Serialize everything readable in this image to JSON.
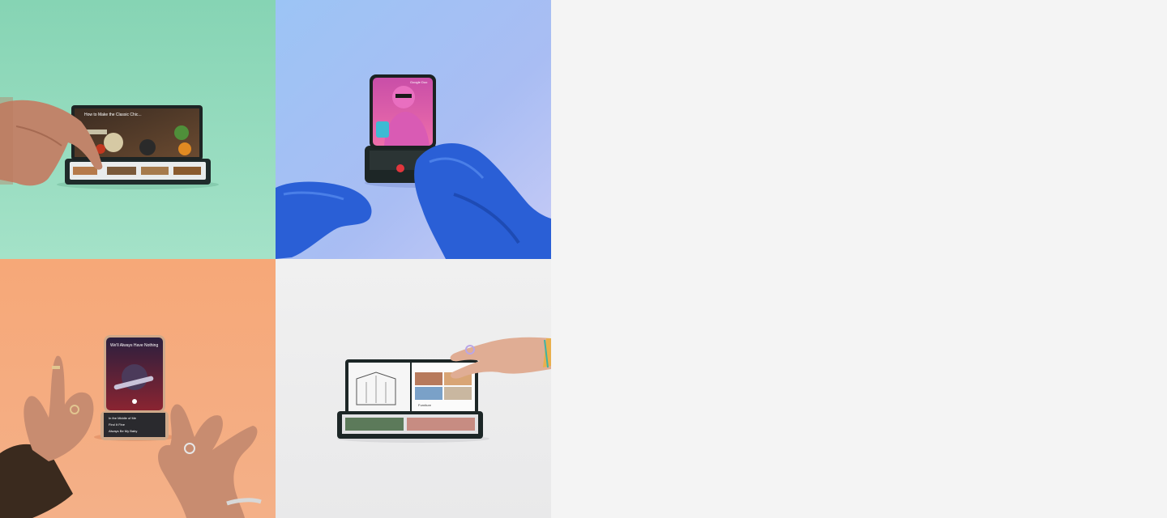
{
  "tiles": [
    {
      "name": "tile-fold-video",
      "background": "#8fd8b9",
      "screen_text": "How to Make the Classic Chic..."
    },
    {
      "name": "tile-flip-camera",
      "background": "#8fb4f0",
      "screen_text": "Google Duo"
    },
    {
      "name": "tile-flip-music",
      "background": "#f5a574",
      "screen_text": "We'll Always Have Nothing",
      "list_items": [
        "In the Middle of Me",
        "Find It Fine",
        "Always Be My Baby"
      ]
    },
    {
      "name": "tile-fold-design",
      "background": "#efefef",
      "screen_text": "Furniture"
    }
  ],
  "colors": {
    "page_background": "#f4f4f4",
    "mint": "#8fd8b9",
    "sky": "#8fb4f0",
    "peach": "#f5a574",
    "light_grey": "#efefef",
    "fur_blue": "#2a5fd6",
    "phone_dark": "#1e2a2a"
  }
}
